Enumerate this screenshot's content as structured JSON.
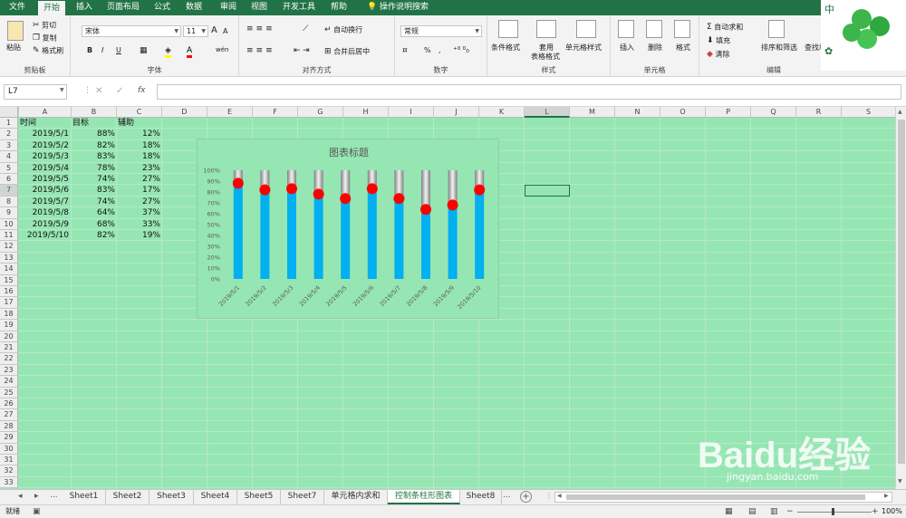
{
  "ribbon_tabs": [
    {
      "label": "文件",
      "active": false
    },
    {
      "label": "开始",
      "active": true
    },
    {
      "label": "插入",
      "active": false
    },
    {
      "label": "页面布局",
      "active": false
    },
    {
      "label": "公式",
      "active": false
    },
    {
      "label": "数据",
      "active": false
    },
    {
      "label": "审阅",
      "active": false
    },
    {
      "label": "视图",
      "active": false
    },
    {
      "label": "开发工具",
      "active": false
    },
    {
      "label": "帮助",
      "active": false
    },
    {
      "label": "操作说明搜索",
      "active": false
    }
  ],
  "clipboard": {
    "paste": "粘贴",
    "cut": "剪切",
    "copy": "复制",
    "format_painter": "格式刷",
    "label": "剪贴板"
  },
  "font": {
    "name": "宋体",
    "size": "11",
    "bold": "B",
    "italic": "I",
    "underline": "U",
    "grow": "A",
    "shrink": "A",
    "wen": "wén",
    "label": "字体"
  },
  "align": {
    "wrap": "自动换行",
    "merge": "合并后居中",
    "label": "对齐方式"
  },
  "number": {
    "format": "常规",
    "percent": "%",
    "comma": ",",
    "label": "数字"
  },
  "styles": {
    "cond": "条件格式",
    "table_1": "套用",
    "table_2": "表格格式",
    "cell_style": "单元格样式",
    "label": "样式"
  },
  "cells": {
    "insert": "插入",
    "delete": "删除",
    "format": "格式",
    "label": "单元格"
  },
  "editing": {
    "autosum": "自动求和",
    "fill": "填充",
    "clear": "清除",
    "sort": "排序和筛选",
    "find": "查找和选择",
    "label": "编辑"
  },
  "corner_text": "中",
  "formula_bar": {
    "name_box": "L7",
    "fx": "fx",
    "value": ""
  },
  "columns": [
    "A",
    "B",
    "C",
    "D",
    "E",
    "F",
    "G",
    "H",
    "I",
    "J",
    "K",
    "L",
    "M",
    "N",
    "O",
    "P",
    "Q",
    "R",
    "S"
  ],
  "selected_column": "L",
  "selected_row": "7",
  "rows": [
    "1",
    "2",
    "3",
    "4",
    "5",
    "6",
    "7",
    "8",
    "9",
    "10",
    "11",
    "12",
    "13",
    "14",
    "15",
    "16",
    "17",
    "18",
    "19",
    "20",
    "21",
    "22",
    "23",
    "24",
    "25",
    "26",
    "27",
    "28",
    "29",
    "30",
    "31",
    "32",
    "33"
  ],
  "table": {
    "headers": [
      "时间",
      "目标",
      "辅助"
    ],
    "rows": [
      [
        "2019/5/1",
        "88%",
        "12%"
      ],
      [
        "2019/5/2",
        "82%",
        "18%"
      ],
      [
        "2019/5/3",
        "83%",
        "18%"
      ],
      [
        "2019/5/4",
        "78%",
        "23%"
      ],
      [
        "2019/5/5",
        "74%",
        "27%"
      ],
      [
        "2019/5/6",
        "83%",
        "17%"
      ],
      [
        "2019/5/7",
        "74%",
        "27%"
      ],
      [
        "2019/5/8",
        "64%",
        "37%"
      ],
      [
        "2019/5/9",
        "68%",
        "33%"
      ],
      [
        "2019/5/10",
        "82%",
        "19%"
      ]
    ]
  },
  "chart_data": {
    "type": "bar",
    "title": "图表标题",
    "categories": [
      "2019/5/1",
      "2019/5/2",
      "2019/5/3",
      "2019/5/4",
      "2019/5/5",
      "2019/5/6",
      "2019/5/7",
      "2019/5/8",
      "2019/5/9",
      "2019/5/10"
    ],
    "series": [
      {
        "name": "目标",
        "values": [
          0.88,
          0.82,
          0.83,
          0.78,
          0.74,
          0.83,
          0.74,
          0.64,
          0.68,
          0.82
        ],
        "color": "#00b0f0"
      },
      {
        "name": "辅助",
        "values": [
          0.12,
          0.18,
          0.18,
          0.23,
          0.27,
          0.17,
          0.27,
          0.37,
          0.33,
          0.19
        ],
        "color": "#a6a6a6"
      }
    ],
    "marker_color": "#ff0000",
    "stacked": true,
    "ylim": [
      0,
      1
    ],
    "yticks": [
      "0%",
      "10%",
      "20%",
      "30%",
      "40%",
      "50%",
      "60%",
      "70%",
      "80%",
      "90%",
      "100%"
    ],
    "grid": false,
    "legend": "none"
  },
  "sheet_tabs": [
    {
      "label": "Sheet1",
      "active": false
    },
    {
      "label": "Sheet2",
      "active": false
    },
    {
      "label": "Sheet3",
      "active": false
    },
    {
      "label": "Sheet4",
      "active": false
    },
    {
      "label": "Sheet5",
      "active": false
    },
    {
      "label": "Sheet7",
      "active": false
    },
    {
      "label": "单元格内求和",
      "active": false
    },
    {
      "label": "控制条柱形图表",
      "active": true
    },
    {
      "label": "Sheet8",
      "active": false
    }
  ],
  "sheet_nav": {
    "prev": "◂",
    "next": "▸",
    "more": "...",
    "add": "+"
  },
  "status": {
    "ready": "就绪",
    "zoom": "100%"
  },
  "watermark": {
    "brand": "Baidu经验",
    "url": "jingyan.baidu.com"
  },
  "colors": {
    "excel_green": "#217346",
    "sheet_bg": "#96e6b3"
  }
}
